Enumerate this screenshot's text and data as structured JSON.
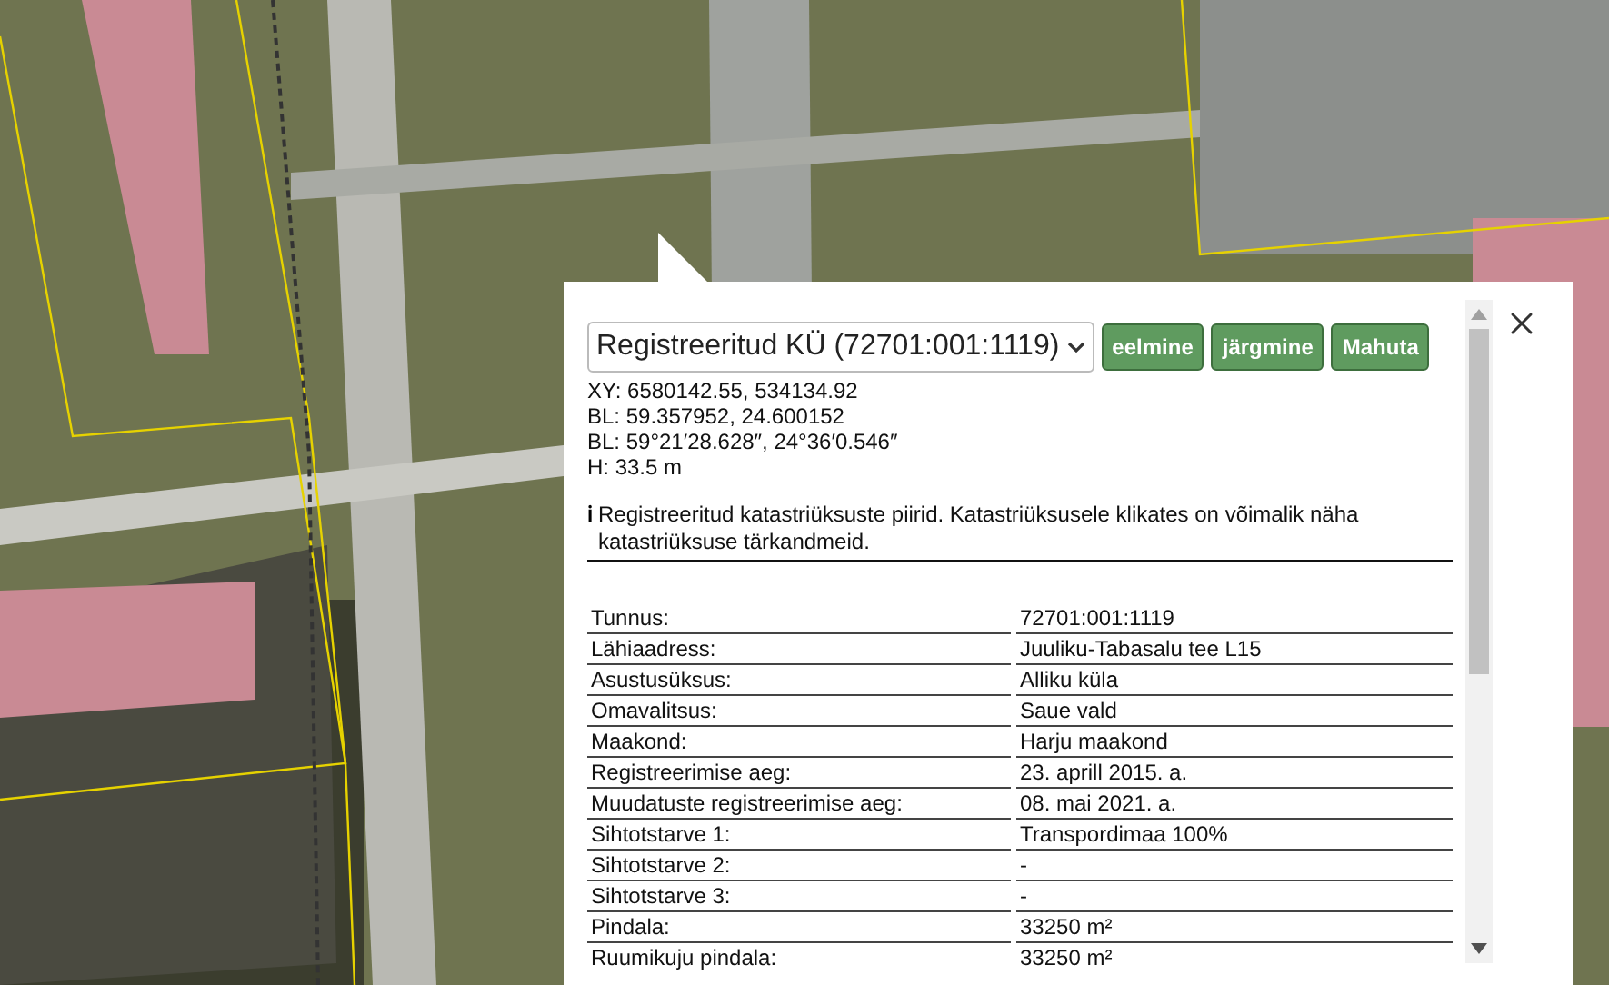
{
  "popup": {
    "layer_select": {
      "value": "Registreeritud KÜ (72701:001:1119)"
    },
    "buttons": [
      "eelmine",
      "järgmine",
      "Mahuta"
    ],
    "coordinates": [
      "XY: 6580142.55, 534134.92",
      "BL: 59.357952, 24.600152",
      "BL: 59°21′28.628″, 24°36′0.546″",
      "H: 33.5 m"
    ],
    "info_icon": "ℹ",
    "info": "Registreeritud katastriüksuste piirid. Katastriüksusele klikates on võimalik näha katastriüksuse tärkandmeid.",
    "rows": [
      {
        "label": "Tunnus:",
        "value": "72701:001:1119"
      },
      {
        "label": "Lähiaadress:",
        "value": "Juuliku-Tabasalu tee L15"
      },
      {
        "label": "Asustusüksus:",
        "value": "Alliku küla"
      },
      {
        "label": "Omavalitsus:",
        "value": "Saue vald"
      },
      {
        "label": "Maakond:",
        "value": "Harju maakond"
      },
      {
        "label": "Registreerimise aeg:",
        "value": "23. aprill 2015. a."
      },
      {
        "label": "Muudatuste registreerimise aeg:",
        "value": "08. mai 2021. a."
      },
      {
        "label": "Sihtotstarve 1:",
        "value": "Transpordimaa 100%"
      },
      {
        "label": "Sihtotstarve 2:",
        "value": "-"
      },
      {
        "label": "Sihtotstarve 3:",
        "value": "-"
      },
      {
        "label": "Pindala:",
        "value": "33250 m²"
      },
      {
        "label": "Ruumikuju pindala:",
        "value": "33250 m²"
      }
    ]
  }
}
